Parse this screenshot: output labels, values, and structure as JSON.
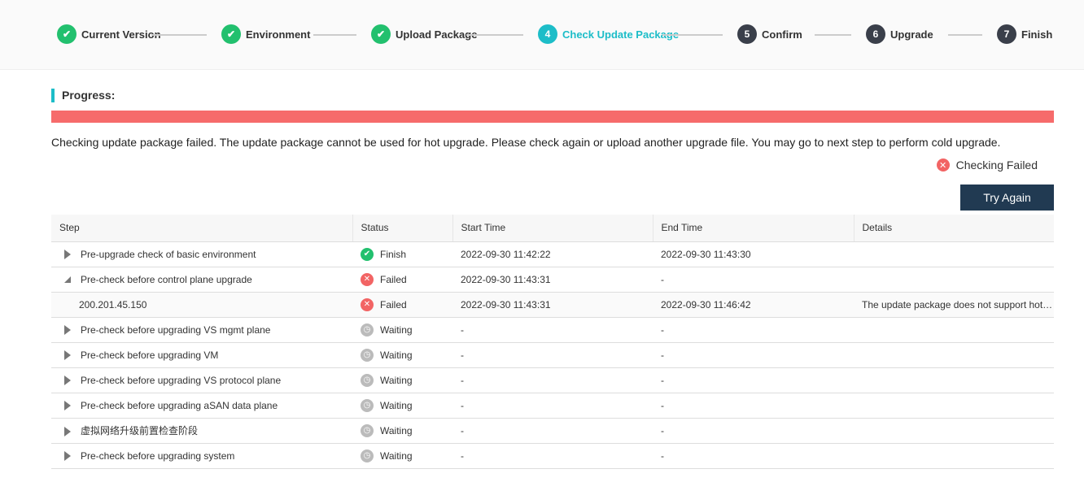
{
  "steps": [
    {
      "num": "1",
      "label": "Current Version",
      "state": "done"
    },
    {
      "num": "2",
      "label": "Environment",
      "state": "done"
    },
    {
      "num": "3",
      "label": "Upload Package",
      "state": "done"
    },
    {
      "num": "4",
      "label": "Check Update Package",
      "state": "current"
    },
    {
      "num": "5",
      "label": "Confirm",
      "state": "todo"
    },
    {
      "num": "6",
      "label": "Upgrade",
      "state": "todo"
    },
    {
      "num": "7",
      "label": "Finish",
      "state": "todo"
    }
  ],
  "progress": {
    "title": "Progress:",
    "percent": 100,
    "color": "#f66b6b",
    "message": "Checking update package failed. The update package cannot be used for hot upgrade. Please check again or upload another upgrade file. You may go to next step to perform cold upgrade.",
    "status": "Checking Failed",
    "try_again": "Try Again"
  },
  "table": {
    "headers": [
      "Step",
      "Status",
      "Start Time",
      "End Time",
      "Details"
    ],
    "rows": [
      {
        "step": "Pre-upgrade check of basic environment",
        "status": "Finish",
        "icon": "ok",
        "start": "2022-09-30 11:42:22",
        "end": "2022-09-30 11:43:30",
        "details": "",
        "expander": "closed"
      },
      {
        "step": "Pre-check before control plane upgrade",
        "status": "Failed",
        "icon": "fail",
        "start": "2022-09-30 11:43:31",
        "end": "-",
        "details": "",
        "expander": "open"
      },
      {
        "step": "200.201.45.150",
        "status": "Failed",
        "icon": "fail",
        "start": "2022-09-30 11:43:31",
        "end": "2022-09-30 11:46:42",
        "details": "The update package does not support hot upgrade",
        "expander": "none"
      },
      {
        "step": "Pre-check before upgrading VS mgmt plane",
        "status": "Waiting",
        "icon": "wait",
        "start": "-",
        "end": "-",
        "details": "",
        "expander": "closed"
      },
      {
        "step": "Pre-check before upgrading VM",
        "status": "Waiting",
        "icon": "wait",
        "start": "-",
        "end": "-",
        "details": "",
        "expander": "closed"
      },
      {
        "step": "Pre-check before upgrading VS protocol plane",
        "status": "Waiting",
        "icon": "wait",
        "start": "-",
        "end": "-",
        "details": "",
        "expander": "closed"
      },
      {
        "step": "Pre-check before upgrading aSAN data plane",
        "status": "Waiting",
        "icon": "wait",
        "start": "-",
        "end": "-",
        "details": "",
        "expander": "closed"
      },
      {
        "step": "虚拟网络升级前置检查阶段",
        "status": "Waiting",
        "icon": "wait",
        "start": "-",
        "end": "-",
        "details": "",
        "expander": "closed"
      },
      {
        "step": "Pre-check before upgrading system",
        "status": "Waiting",
        "icon": "wait",
        "start": "-",
        "end": "-",
        "details": "",
        "expander": "closed"
      }
    ]
  }
}
